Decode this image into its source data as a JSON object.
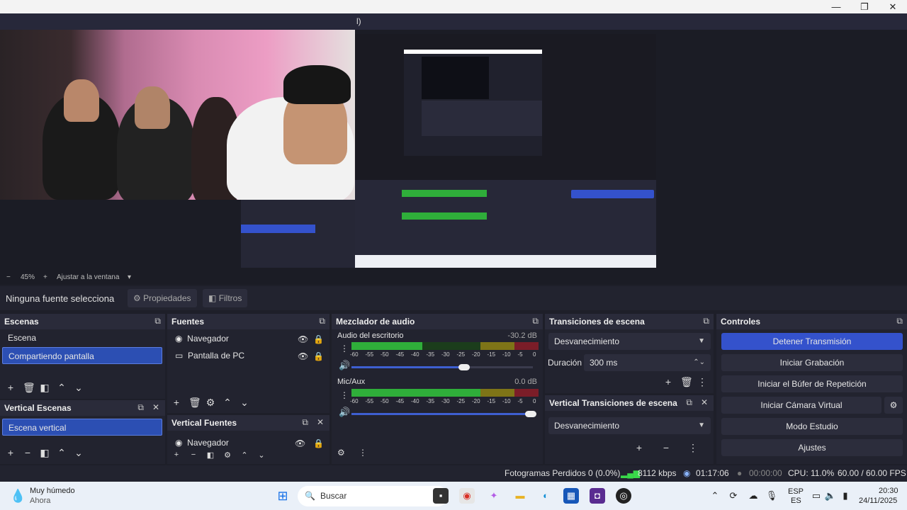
{
  "window": {
    "title_fragment": "l)",
    "controls": [
      "—",
      "❐",
      "✕"
    ]
  },
  "zoom": {
    "minus": "−",
    "percent": "45%",
    "plus": "+",
    "fit_label": "Ajustar a la ventana",
    "dropdown": "▾"
  },
  "source_bar": {
    "no_source": "Ninguna fuente selecciona",
    "properties": "Propiedades",
    "filters": "Filtros"
  },
  "scenes": {
    "title": "Escenas",
    "items": [
      "Escena",
      "Compartiendo pantalla"
    ],
    "selected_index": 1
  },
  "vertical_scenes": {
    "title": "Vertical Escenas",
    "items": [
      "Escena vertical"
    ]
  },
  "sources": {
    "title": "Fuentes",
    "items": [
      {
        "label": "Navegador",
        "icon": "globe-icon"
      },
      {
        "label": "Pantalla de PC",
        "icon": "monitor-icon"
      }
    ]
  },
  "vertical_sources": {
    "title": "Vertical Fuentes",
    "items": [
      {
        "label": "Navegador",
        "icon": "globe-icon"
      }
    ]
  },
  "mixer": {
    "title": "Mezclador de audio",
    "channels": [
      {
        "name": "Audio del escritorio",
        "db": "-30.2 dB",
        "level": 0.38,
        "volume": 0.62
      },
      {
        "name": "Mic/Aux",
        "db": "0.0 dB",
        "level": 0.75,
        "volume": 0.99
      }
    ],
    "ticks": [
      "-60",
      "-55",
      "-50",
      "-45",
      "-40",
      "-35",
      "-30",
      "-25",
      "-20",
      "-15",
      "-10",
      "-5",
      "0"
    ]
  },
  "transitions": {
    "title": "Transiciones de escena",
    "selected": "Desvanecimiento",
    "duration_label": "Duración",
    "duration_value": "300 ms"
  },
  "vertical_transitions": {
    "title": "Vertical Transiciones de escena",
    "selected": "Desvanecimiento"
  },
  "controls": {
    "title": "Controles",
    "buttons": [
      "Detener Transmisión",
      "Iniciar Grabación",
      "Iniciar el Búfer de Repetición",
      "Iniciar Cámara Virtual",
      "Modo Estudio",
      "Ajustes"
    ]
  },
  "status": {
    "dropped": "Fotogramas Perdidos 0 (0.0%)",
    "bitrate": "8112 kbps",
    "stream_time": "01:17:06",
    "rec_time": "00:00:00",
    "cpu": "CPU: 11.0%",
    "fps": "60.00 / 60.00 FPS"
  },
  "taskbar": {
    "weather_title": "Muy húmedo",
    "weather_sub": "Ahora",
    "search_placeholder": "Buscar",
    "lang_top": "ESP",
    "lang_bottom": "ES",
    "time": "20:30",
    "date": "24/11/2025"
  },
  "colors": {
    "accent": "#3452cc",
    "panel": "#22232f",
    "selected": "#2c4fb3"
  }
}
